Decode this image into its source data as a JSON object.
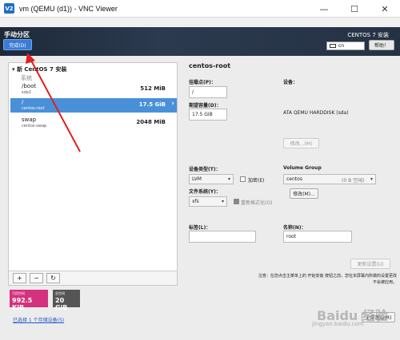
{
  "window": {
    "icon": "V2",
    "title": "vm (QEMU (d1)) - VNC Viewer",
    "controls": [
      "—",
      "☐",
      "✕"
    ]
  },
  "header": {
    "title": "手动分区",
    "done_label": "完成(D)",
    "product": "CENTOS 7 安装",
    "keyboard": "cn",
    "help_label": "帮助！"
  },
  "left": {
    "root": "▾ 新 CentOS 7 安装",
    "system": "系统",
    "mounts": [
      {
        "name": "/boot",
        "device": "sda1",
        "size": "512 MiB",
        "selected": false
      },
      {
        "name": "/",
        "device": "centos-root",
        "size": "17.5 GiB",
        "selected": true
      },
      {
        "name": "swap",
        "device": "centos-swap",
        "size": "2048 MiB",
        "selected": false
      }
    ],
    "tools": [
      "+",
      "−",
      "↻"
    ],
    "available_label": "可用空间",
    "available_value": "992.5 KiB",
    "total_label": "总空间",
    "total_value": "20 GiB",
    "storage_link": "已选择 1 个存储设备(S)"
  },
  "right": {
    "title": "centos-root",
    "mount_point_label": "挂载点(P)：",
    "mount_point_value": "/",
    "device_label": "设备：",
    "capacity_label": "期望容量(D)：",
    "capacity_value": "17.5 GiB",
    "device_value": "ATA QEMU HARDDISK (sda)",
    "modify_label": "修改...(M)",
    "device_type_label": "设备类型(T)：",
    "device_type_value": "LVM",
    "encrypt_label": "加密(E)",
    "volume_group_label": "Volume Group",
    "volume_group_value": "centos",
    "volume_group_free": "(0 B 空闲)",
    "modify2_label": "修改(M)...",
    "fs_label": "文件系统(Y)：",
    "fs_value": "xfs",
    "reformat_label": "重新格式化(O)",
    "tag_label": "标签(L)：",
    "tag_value": "",
    "name_label": "名称(N)：",
    "name_value": "root",
    "update_label": "更新设置(U)",
    "note": "注意：在您点击主菜单上的 开始安装 按钮之前，您在本屏幕内所做的设置更改不会被应用。",
    "reset_label": "全部重设(R)"
  },
  "watermark": {
    "main": "Baidu 经验",
    "sub": "jingyan.baidu.com"
  },
  "colors": {
    "header": "#263244",
    "selected": "#4a90d9",
    "available": "#d4317e",
    "arrow": "#e02020"
  }
}
